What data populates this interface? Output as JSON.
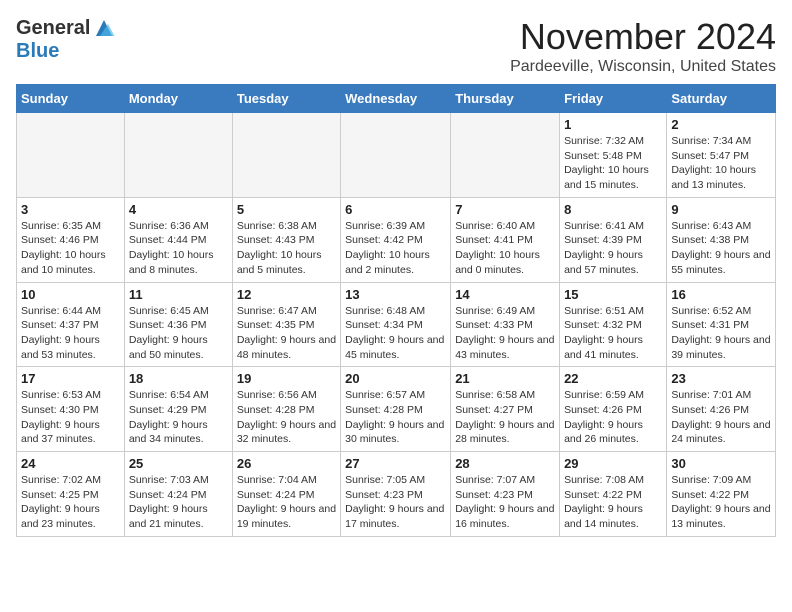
{
  "header": {
    "logo_general": "General",
    "logo_blue": "Blue",
    "month_title": "November 2024",
    "location": "Pardeeville, Wisconsin, United States"
  },
  "weekdays": [
    "Sunday",
    "Monday",
    "Tuesday",
    "Wednesday",
    "Thursday",
    "Friday",
    "Saturday"
  ],
  "weeks": [
    [
      {
        "day": "",
        "info": ""
      },
      {
        "day": "",
        "info": ""
      },
      {
        "day": "",
        "info": ""
      },
      {
        "day": "",
        "info": ""
      },
      {
        "day": "",
        "info": ""
      },
      {
        "day": "1",
        "info": "Sunrise: 7:32 AM\nSunset: 5:48 PM\nDaylight: 10 hours and 15 minutes."
      },
      {
        "day": "2",
        "info": "Sunrise: 7:34 AM\nSunset: 5:47 PM\nDaylight: 10 hours and 13 minutes."
      }
    ],
    [
      {
        "day": "3",
        "info": "Sunrise: 6:35 AM\nSunset: 4:46 PM\nDaylight: 10 hours and 10 minutes."
      },
      {
        "day": "4",
        "info": "Sunrise: 6:36 AM\nSunset: 4:44 PM\nDaylight: 10 hours and 8 minutes."
      },
      {
        "day": "5",
        "info": "Sunrise: 6:38 AM\nSunset: 4:43 PM\nDaylight: 10 hours and 5 minutes."
      },
      {
        "day": "6",
        "info": "Sunrise: 6:39 AM\nSunset: 4:42 PM\nDaylight: 10 hours and 2 minutes."
      },
      {
        "day": "7",
        "info": "Sunrise: 6:40 AM\nSunset: 4:41 PM\nDaylight: 10 hours and 0 minutes."
      },
      {
        "day": "8",
        "info": "Sunrise: 6:41 AM\nSunset: 4:39 PM\nDaylight: 9 hours and 57 minutes."
      },
      {
        "day": "9",
        "info": "Sunrise: 6:43 AM\nSunset: 4:38 PM\nDaylight: 9 hours and 55 minutes."
      }
    ],
    [
      {
        "day": "10",
        "info": "Sunrise: 6:44 AM\nSunset: 4:37 PM\nDaylight: 9 hours and 53 minutes."
      },
      {
        "day": "11",
        "info": "Sunrise: 6:45 AM\nSunset: 4:36 PM\nDaylight: 9 hours and 50 minutes."
      },
      {
        "day": "12",
        "info": "Sunrise: 6:47 AM\nSunset: 4:35 PM\nDaylight: 9 hours and 48 minutes."
      },
      {
        "day": "13",
        "info": "Sunrise: 6:48 AM\nSunset: 4:34 PM\nDaylight: 9 hours and 45 minutes."
      },
      {
        "day": "14",
        "info": "Sunrise: 6:49 AM\nSunset: 4:33 PM\nDaylight: 9 hours and 43 minutes."
      },
      {
        "day": "15",
        "info": "Sunrise: 6:51 AM\nSunset: 4:32 PM\nDaylight: 9 hours and 41 minutes."
      },
      {
        "day": "16",
        "info": "Sunrise: 6:52 AM\nSunset: 4:31 PM\nDaylight: 9 hours and 39 minutes."
      }
    ],
    [
      {
        "day": "17",
        "info": "Sunrise: 6:53 AM\nSunset: 4:30 PM\nDaylight: 9 hours and 37 minutes."
      },
      {
        "day": "18",
        "info": "Sunrise: 6:54 AM\nSunset: 4:29 PM\nDaylight: 9 hours and 34 minutes."
      },
      {
        "day": "19",
        "info": "Sunrise: 6:56 AM\nSunset: 4:28 PM\nDaylight: 9 hours and 32 minutes."
      },
      {
        "day": "20",
        "info": "Sunrise: 6:57 AM\nSunset: 4:28 PM\nDaylight: 9 hours and 30 minutes."
      },
      {
        "day": "21",
        "info": "Sunrise: 6:58 AM\nSunset: 4:27 PM\nDaylight: 9 hours and 28 minutes."
      },
      {
        "day": "22",
        "info": "Sunrise: 6:59 AM\nSunset: 4:26 PM\nDaylight: 9 hours and 26 minutes."
      },
      {
        "day": "23",
        "info": "Sunrise: 7:01 AM\nSunset: 4:26 PM\nDaylight: 9 hours and 24 minutes."
      }
    ],
    [
      {
        "day": "24",
        "info": "Sunrise: 7:02 AM\nSunset: 4:25 PM\nDaylight: 9 hours and 23 minutes."
      },
      {
        "day": "25",
        "info": "Sunrise: 7:03 AM\nSunset: 4:24 PM\nDaylight: 9 hours and 21 minutes."
      },
      {
        "day": "26",
        "info": "Sunrise: 7:04 AM\nSunset: 4:24 PM\nDaylight: 9 hours and 19 minutes."
      },
      {
        "day": "27",
        "info": "Sunrise: 7:05 AM\nSunset: 4:23 PM\nDaylight: 9 hours and 17 minutes."
      },
      {
        "day": "28",
        "info": "Sunrise: 7:07 AM\nSunset: 4:23 PM\nDaylight: 9 hours and 16 minutes."
      },
      {
        "day": "29",
        "info": "Sunrise: 7:08 AM\nSunset: 4:22 PM\nDaylight: 9 hours and 14 minutes."
      },
      {
        "day": "30",
        "info": "Sunrise: 7:09 AM\nSunset: 4:22 PM\nDaylight: 9 hours and 13 minutes."
      }
    ]
  ]
}
